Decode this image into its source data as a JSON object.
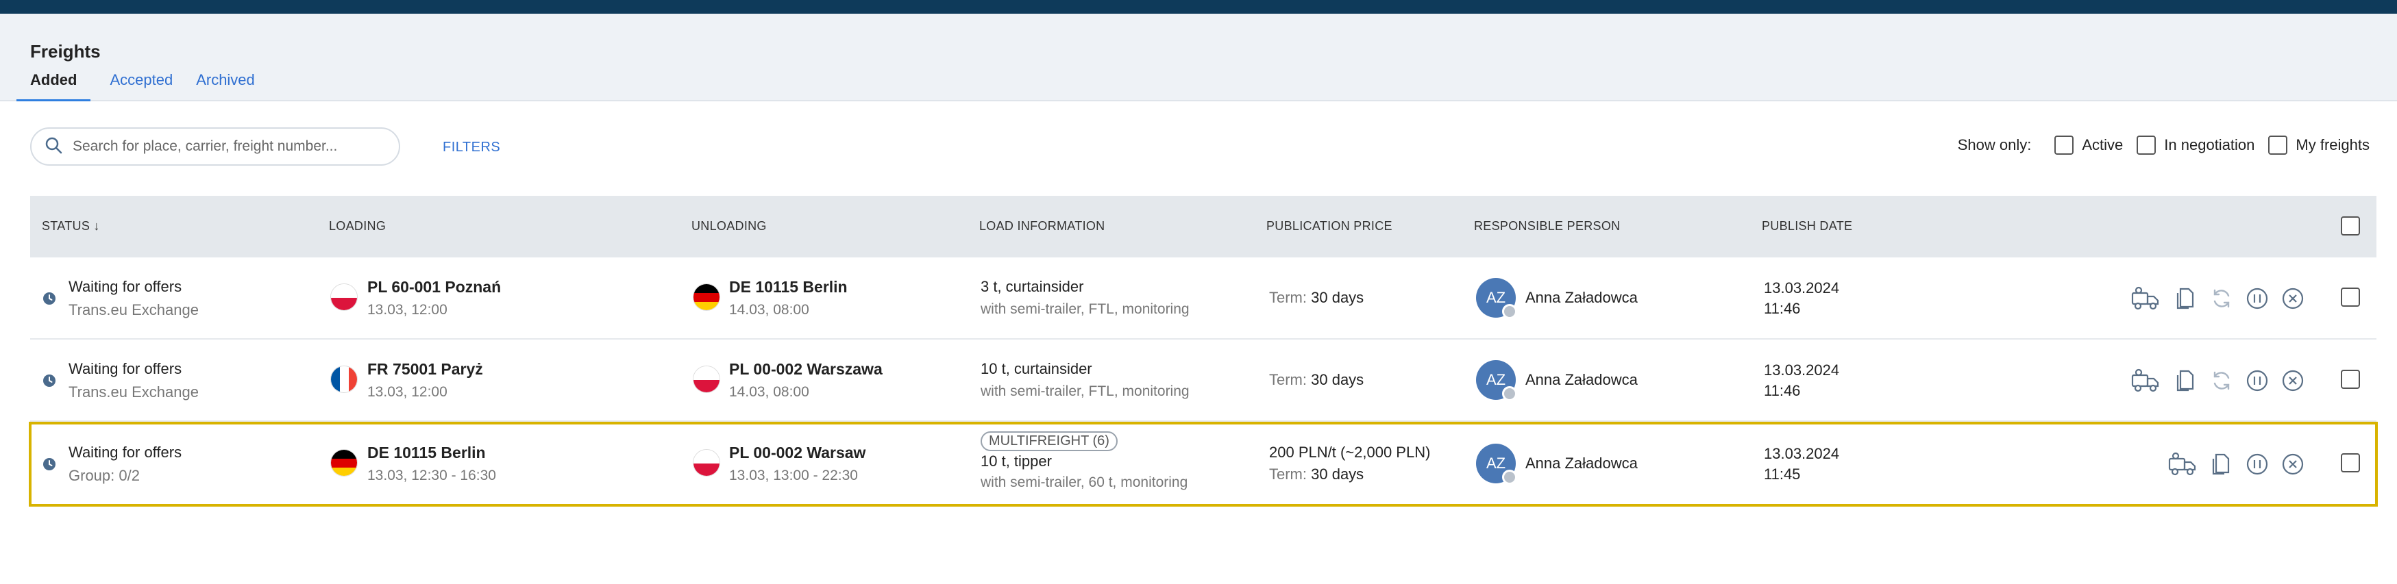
{
  "page": {
    "title": "Freights"
  },
  "tabs": [
    {
      "label": "Added"
    },
    {
      "label": "Accepted"
    },
    {
      "label": "Archived"
    }
  ],
  "search": {
    "placeholder": "Search for place, carrier, freight number..."
  },
  "filters_label": "FILTERS",
  "show_only": {
    "label": "Show only:",
    "options": [
      {
        "label": "Active",
        "checked": false
      },
      {
        "label": "In negotiation",
        "checked": false
      },
      {
        "label": "My freights",
        "checked": false
      }
    ]
  },
  "table": {
    "headers": {
      "status": "STATUS ↓",
      "loading": "LOADING",
      "unloading": "UNLOADING",
      "load_info": "LOAD INFORMATION",
      "price": "PUBLICATION PRICE",
      "person": "RESPONSIBLE PERSON",
      "publish": "PUBLISH DATE"
    },
    "rows": [
      {
        "status": "Waiting for offers",
        "status_sub": "Trans.eu Exchange",
        "loading_flag": "PL",
        "loading_place": "PL 60-001 Poznań",
        "loading_date": "13.03, 12:00",
        "unloading_flag": "DE",
        "unloading_place": "DE 10115 Berlin",
        "unloading_date": "14.03, 08:00",
        "multifreight": "",
        "load_main": "3 t, curtainsider",
        "load_sub": "with semi-trailer, FTL, monitoring",
        "price_value": "",
        "term_label": "Term:",
        "term_value": "30 days",
        "initials": "AZ",
        "person": "Anna Załadowca",
        "publish_date": "13.03.2024",
        "publish_time": "11:46"
      },
      {
        "status": "Waiting for offers",
        "status_sub": "Trans.eu Exchange",
        "loading_flag": "FR",
        "loading_place": "FR 75001 Paryż",
        "loading_date": "13.03, 12:00",
        "unloading_flag": "PL",
        "unloading_place": "PL 00-002 Warszawa",
        "unloading_date": "14.03, 08:00",
        "multifreight": "",
        "load_main": "10 t, curtainsider",
        "load_sub": "with semi-trailer, FTL, monitoring",
        "price_value": "",
        "term_label": "Term:",
        "term_value": "30 days",
        "initials": "AZ",
        "person": "Anna Załadowca",
        "publish_date": "13.03.2024",
        "publish_time": "11:46"
      },
      {
        "status": "Waiting for offers",
        "status_sub": "Group: 0/2",
        "loading_flag": "DE",
        "loading_place": "DE 10115 Berlin",
        "loading_date": "13.03, 12:30 - 16:30",
        "unloading_flag": "PL",
        "unloading_place": "PL 00-002 Warsaw",
        "unloading_date": "13.03, 13:00 - 22:30",
        "multifreight": "MULTIFREIGHT (6)",
        "load_main": "10 t, tipper",
        "load_sub": "with semi-trailer, 60 t, monitoring",
        "price_value": "200 PLN/t (~2,000 PLN)",
        "term_label": "Term:",
        "term_value": "30 days",
        "initials": "AZ",
        "person": "Anna Załadowca",
        "publish_date": "13.03.2024",
        "publish_time": "11:45"
      }
    ]
  },
  "colors": {
    "accent": "#2f6fd1",
    "highlight_border": "#d8b300",
    "avatar": "#4a78b5",
    "icon": "#5a6f86",
    "icon_disabled": "#aab6c4"
  },
  "icons": {
    "search": "magnifier-icon",
    "clock": "clock-icon",
    "actions": [
      "truck-offer-icon",
      "copy-document-icon",
      "refresh-icon",
      "pause-icon",
      "cancel-icon"
    ]
  }
}
